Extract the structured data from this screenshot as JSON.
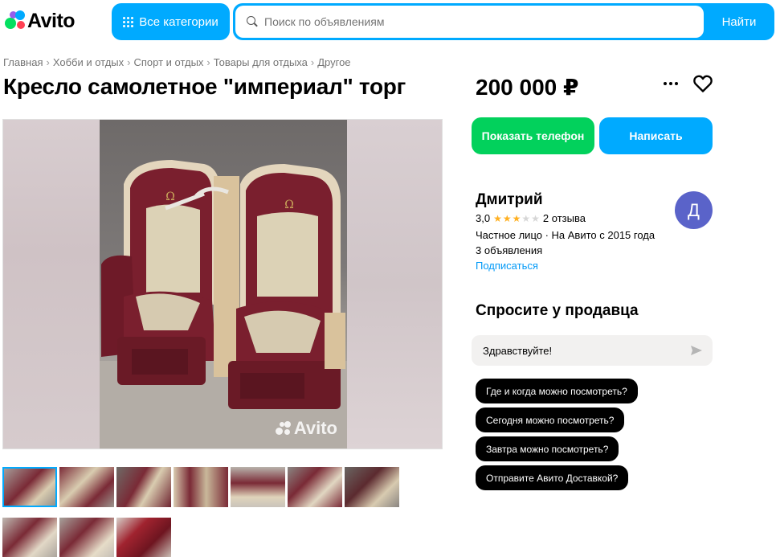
{
  "header": {
    "logo_text": "Avito",
    "categories_label": "Все категории",
    "search_placeholder": "Поиск по объявлениям",
    "search_button": "Найти"
  },
  "breadcrumb": [
    "Главная",
    "Хобби и отдых",
    "Спорт и отдых",
    "Товары для отдыха",
    "Другое"
  ],
  "listing": {
    "title": "Кресло самолетное \"империал\" торг",
    "price": "200 000 ₽",
    "watermark": "Avito",
    "thumbnail_count": 10
  },
  "actions": {
    "show_phone": "Показать телефон",
    "write": "Написать"
  },
  "seller": {
    "name": "Дмитрий",
    "rating": "3,0",
    "stars_filled": 3,
    "stars_total": 5,
    "reviews": "2 отзыва",
    "type_since": "Частное лицо · На Авито с 2015 года",
    "ads_count": "3 объявления",
    "subscribe": "Подписаться",
    "avatar_letter": "Д",
    "avatar_color": "#5a63c9"
  },
  "ask": {
    "title": "Спросите у продавца",
    "message_value": "Здравствуйте!",
    "quick_questions": [
      "Где и когда можно посмотреть?",
      "Сегодня можно посмотреть?",
      "Завтра можно посмотреть?",
      "Отправите Авито Доставкой?"
    ]
  },
  "colors": {
    "accent_blue": "#00aaff",
    "green": "#02d15c",
    "link": "#0099f7"
  }
}
